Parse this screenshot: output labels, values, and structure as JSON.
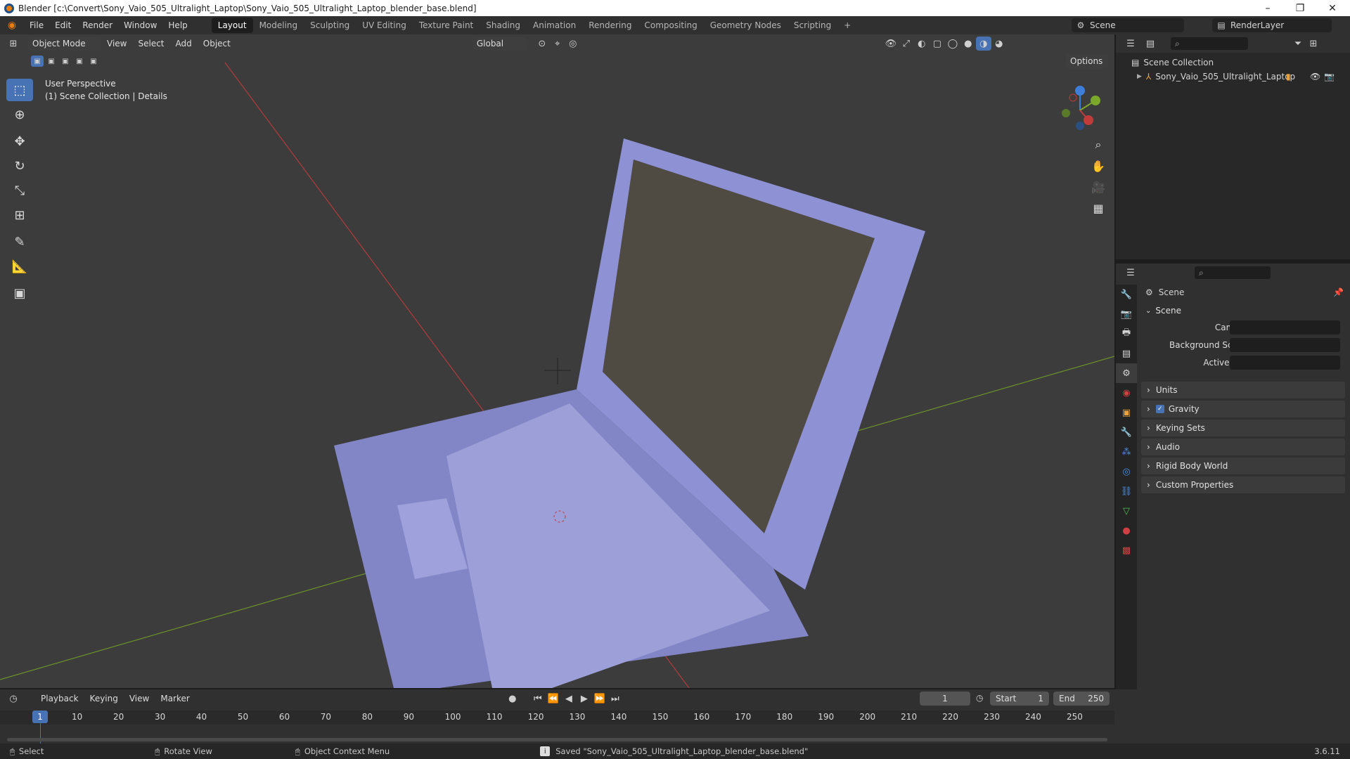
{
  "window": {
    "title": "Blender [c:\\Convert\\Sony_Vaio_505_Ultralight_Laptop\\Sony_Vaio_505_Ultralight_Laptop_blender_base.blend]",
    "controls": [
      "–",
      "❐",
      "✕"
    ]
  },
  "menu": [
    "File",
    "Edit",
    "Render",
    "Window",
    "Help"
  ],
  "workspaces": [
    "Layout",
    "Modeling",
    "Sculpting",
    "UV Editing",
    "Texture Paint",
    "Shading",
    "Animation",
    "Rendering",
    "Compositing",
    "Geometry Nodes",
    "Scripting"
  ],
  "active_workspace": "Layout",
  "scene_selector": "Scene",
  "view_layer": "RenderLayer",
  "viewport_header": {
    "mode": "Object Mode",
    "menus": [
      "View",
      "Select",
      "Add",
      "Object"
    ],
    "transform_orientation": "Global",
    "options_label": "Options"
  },
  "viewport_overlay": {
    "line1": "User Perspective",
    "line2": "(1) Scene Collection | Details"
  },
  "outliner": {
    "collection": "Scene Collection",
    "object": "Sony_Vaio_505_Ultralight_Laptop"
  },
  "properties": {
    "header": "Scene",
    "panel": "Scene",
    "fields": [
      {
        "label": "Camera"
      },
      {
        "label": "Background Scene"
      },
      {
        "label": "Active Clip"
      }
    ],
    "sections": [
      "Units",
      "Gravity",
      "Keying Sets",
      "Audio",
      "Rigid Body World",
      "Custom Properties"
    ],
    "gravity_checked": true
  },
  "timeline": {
    "menus": [
      "Playback",
      "Keying",
      "View",
      "Marker"
    ],
    "current_frame": "1",
    "start_label": "Start",
    "start": "1",
    "end_label": "End",
    "end": "250",
    "ticks": [
      "1",
      "10",
      "20",
      "30",
      "40",
      "50",
      "60",
      "70",
      "80",
      "90",
      "100",
      "110",
      "120",
      "130",
      "140",
      "150",
      "160",
      "170",
      "180",
      "190",
      "200",
      "210",
      "220",
      "230",
      "240",
      "250"
    ]
  },
  "status_bar": {
    "select": "Select",
    "rotate": "Rotate View",
    "context": "Object Context Menu",
    "message": "Saved \"Sony_Vaio_505_Ultralight_Laptop_blender_base.blend\"",
    "version": "3.6.11"
  },
  "colors": {
    "accent": "#4772b3",
    "x_axis": "#c23b3b",
    "y_axis": "#7ba82a",
    "z_axis": "#3d7ed8",
    "laptop": "#8c8fd2"
  }
}
